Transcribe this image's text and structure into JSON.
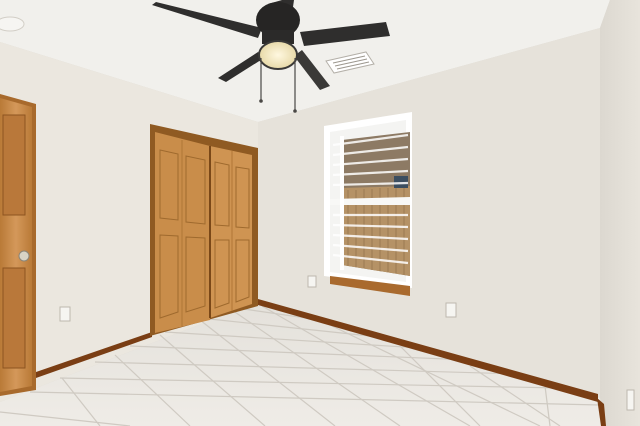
{
  "scene": {
    "title": "",
    "elements": [
      "ceiling",
      "ceiling-fan",
      "air-vent",
      "left-wall",
      "back-wall",
      "right-wall",
      "tile-floor",
      "baseboard",
      "bedroom-door",
      "bifold-closet-doors",
      "window-with-blinds",
      "electrical-outlets"
    ]
  },
  "colors": {
    "ceiling": "#f1f0ec",
    "wall_back": "#e6e2da",
    "wall_left": "#ebe7df",
    "wall_right": "#e1ddd5",
    "floor": "#e9e6e0",
    "grout": "#cfcac2",
    "baseboard": "#7a3e14",
    "wood": "#c68a45",
    "wood_dark": "#9a6226",
    "fan_dark": "#2b2b2b",
    "light_globe": "#f3e8c8",
    "blinds": "#f4f4f2",
    "fence": "#b59266"
  }
}
